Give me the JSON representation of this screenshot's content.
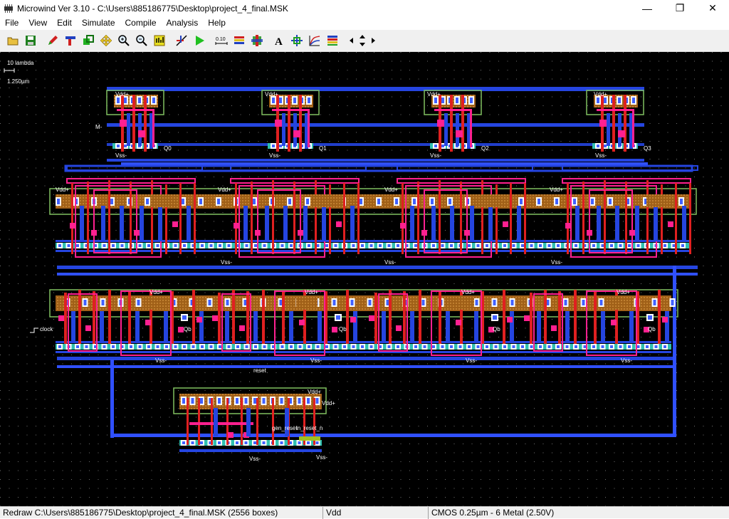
{
  "window": {
    "title": "Microwind Ver 3.10 - C:\\Users\\885186775\\Desktop\\project_4_final.MSK",
    "minimize_glyph": "—",
    "maximize_glyph": "❐",
    "close_glyph": "✕"
  },
  "menu": [
    "File",
    "View",
    "Edit",
    "Simulate",
    "Compile",
    "Analysis",
    "Help"
  ],
  "toolbar": {
    "icons": [
      "open-icon",
      "save-icon",
      "pencil-icon",
      "connector-icon",
      "duplicate-icon",
      "move-icon",
      "zoom-in-icon",
      "zoom-out-icon",
      "view-all-icon",
      "distance-icon",
      "run-icon",
      "scale-icon",
      "stack-icon",
      "mosfet-icon",
      "text-icon",
      "drc-icon",
      "analysis-icon",
      "layers-icon",
      "navigate-icon"
    ],
    "scale_label": "0.10",
    "text_tool_label": "A"
  },
  "scale": {
    "lambda_label": "10 lambda",
    "micron_label": "1.250µm"
  },
  "layout_labels": {
    "vdd": "Vdd+",
    "vss": "Vss-",
    "q0": "Q0",
    "q1": "Q1",
    "q2": "Q2",
    "q3": "Q3",
    "clock": "clock",
    "reset": "reset",
    "m": "M-",
    "qb": "Qb",
    "gen_reset": "gen_reset",
    "in_reset_n": "in_reset_n"
  },
  "status": {
    "left": "Redraw C:\\Users\\885186775\\Desktop\\project_4_final.MSK (2556 boxes)",
    "middle": "Vdd",
    "right": "CMOS 0.25µm - 6 Metal (2.50V)"
  },
  "colors": {
    "metal1": "#1f3fd8",
    "metal2": "#3f5fff",
    "poly": "#e02020",
    "diffusion_n": "#38c8b8",
    "diffusion_p": "#9a6020",
    "contact": "#ffffff",
    "via": "#ff2090",
    "nwell": "#80c060",
    "background": "#000000",
    "dots": "#808080"
  }
}
